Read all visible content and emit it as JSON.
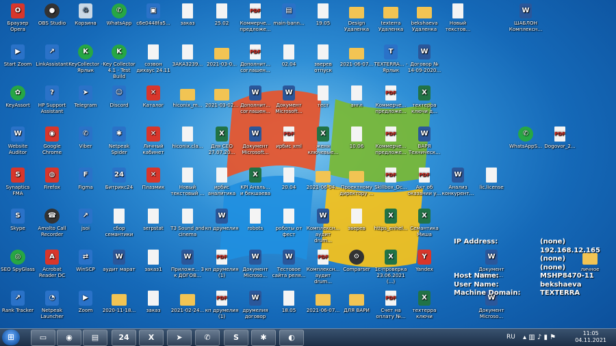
{
  "desktop": {
    "icons": [
      {
        "id": "opera",
        "label": "Браузер Opera",
        "glyph": "O",
        "kind": "red"
      },
      {
        "id": "obs",
        "label": "OBS Studio",
        "glyph": "●",
        "kind": "dark"
      },
      {
        "id": "recycle",
        "label": "Корзина",
        "glyph": "♻",
        "kind": "bin"
      },
      {
        "id": "whatsapp",
        "label": "WhatsApp",
        "glyph": "✆",
        "kind": "green"
      },
      {
        "id": "c6e",
        "label": "c6e0448fa5...",
        "glyph": "▣",
        "kind": "app"
      },
      {
        "id": "zakaz",
        "label": "заказ",
        "glyph": "",
        "kind": "file"
      },
      {
        "id": "d2502",
        "label": "25.02",
        "glyph": "",
        "kind": "file"
      },
      {
        "id": "kommerch1",
        "label": "Коммерче... предложе...",
        "glyph": "PDF",
        "kind": "pdf"
      },
      {
        "id": "mainbann",
        "label": "main-bann...",
        "glyph": "▤",
        "kind": "app"
      },
      {
        "id": "d1905",
        "label": "19.05",
        "glyph": "",
        "kind": "file"
      },
      {
        "id": "design",
        "label": "Design Удаленка",
        "glyph": "",
        "kind": "folder"
      },
      {
        "id": "texterra",
        "label": "texterra Удаленка",
        "glyph": "",
        "kind": "folder"
      },
      {
        "id": "bekshaeva",
        "label": "bekshaeva Удаленка",
        "glyph": "",
        "kind": "folder"
      },
      {
        "id": "newtext",
        "label": "Новый текстов...",
        "glyph": "",
        "kind": "file"
      },
      {
        "id": "shablon",
        "label": "ШАБЛОН Комплексн...",
        "glyph": "W",
        "kind": "word"
      },
      {
        "id": "startzoom",
        "label": "Start Zoom",
        "glyph": "▶",
        "kind": "app"
      },
      {
        "id": "linkassistant",
        "label": "LinkAssistant",
        "glyph": "↗",
        "kind": "app"
      },
      {
        "id": "keycollector",
        "label": "KeyCollector - Ярлык",
        "glyph": "K",
        "kind": "green"
      },
      {
        "id": "keycollector41",
        "label": "Key Collector 4.1 - Test Build",
        "glyph": "K",
        "kind": "green"
      },
      {
        "id": "sozvon",
        "label": "созвон дихаус 24.11",
        "glyph": "",
        "kind": "file"
      },
      {
        "id": "zaka3239",
        "label": "ЗАКА3239...",
        "glyph": "",
        "kind": "file"
      },
      {
        "id": "f2021_03_0",
        "label": "2021-03-0...",
        "glyph": "",
        "kind": "folder"
      },
      {
        "id": "dopoln1",
        "label": "Дополнит... соглашен...",
        "glyph": "PDF",
        "kind": "pdf"
      },
      {
        "id": "d0204",
        "label": "02.04",
        "glyph": "",
        "kind": "file"
      },
      {
        "id": "zvereev",
        "label": "зверев отпуск",
        "glyph": "",
        "kind": "file"
      },
      {
        "id": "f2021_06_07",
        "label": "2021-06-07...",
        "glyph": "",
        "kind": "folder"
      },
      {
        "id": "texterra_y",
        "label": "TEXTERRA... - Ярлык",
        "glyph": "T",
        "kind": "app"
      },
      {
        "id": "dogovor",
        "label": "Договор № 14-09-2020...",
        "glyph": "W",
        "kind": "word"
      },
      {
        "id": "keyassort",
        "label": "KeyAssort",
        "glyph": "✿",
        "kind": "green"
      },
      {
        "id": "hpsupport",
        "label": "HP Support Assistant",
        "glyph": "?",
        "kind": "app"
      },
      {
        "id": "telegram",
        "label": "Telegram",
        "glyph": "➤",
        "kind": "app"
      },
      {
        "id": "discord",
        "label": "Discord",
        "glyph": "☺",
        "kind": "app"
      },
      {
        "id": "katalog",
        "label": "Каталог",
        "glyph": "✕",
        "kind": "red"
      },
      {
        "id": "hiconix_m",
        "label": "hiconix_m...",
        "glyph": "",
        "kind": "folder"
      },
      {
        "id": "f2021_03_02",
        "label": "2021-03-02...",
        "glyph": "",
        "kind": "folder"
      },
      {
        "id": "dopoln2",
        "label": "Дополнит... соглашен...",
        "glyph": "W",
        "kind": "word"
      },
      {
        "id": "doc_ms1",
        "label": "Документ Microsoft...",
        "glyph": "W",
        "kind": "word"
      },
      {
        "id": "test",
        "label": "тест",
        "glyph": "",
        "kind": "file"
      },
      {
        "id": "angl",
        "label": "англ",
        "glyph": "",
        "kind": "file"
      },
      {
        "id": "kommerch2",
        "label": "Коммерче... предложе...",
        "glyph": "PDF",
        "kind": "pdf"
      },
      {
        "id": "texterra_keys",
        "label": "техтерра ключи д...",
        "glyph": "X",
        "kind": "excel"
      },
      {
        "id": "websiteauditor",
        "label": "Website Auditor",
        "glyph": "W",
        "kind": "app"
      },
      {
        "id": "chrome",
        "label": "Google Chrome",
        "glyph": "◉",
        "kind": "red"
      },
      {
        "id": "viber",
        "label": "Viber",
        "glyph": "✆",
        "kind": "app"
      },
      {
        "id": "netpeak",
        "label": "Netpeak Spider",
        "glyph": "✱",
        "kind": "app"
      },
      {
        "id": "lichkab",
        "label": "Личный кабинет",
        "glyph": "✕",
        "kind": "red"
      },
      {
        "id": "hiconix_cla",
        "label": "hiconix.cla...",
        "glyph": "",
        "kind": "file"
      },
      {
        "id": "dlyaceo",
        "label": "Для CEO 27.07.20...",
        "glyph": "X",
        "kind": "excel"
      },
      {
        "id": "doc_ms2",
        "label": "Документ Microsoft...",
        "glyph": "W",
        "kind": "word"
      },
      {
        "id": "irbis_xml",
        "label": "ирбис xml",
        "glyph": "PDF",
        "kind": "pdf"
      },
      {
        "id": "zhenya",
        "label": "женя ключевые...",
        "glyph": "X",
        "kind": "excel"
      },
      {
        "id": "d1006",
        "label": "10.06",
        "glyph": "",
        "kind": "file"
      },
      {
        "id": "kommerch3",
        "label": "Коммерче... предложе...",
        "glyph": "PDF",
        "kind": "pdf"
      },
      {
        "id": "varya_tech",
        "label": "ВАРЯ Техническ...",
        "glyph": "W",
        "kind": "word"
      },
      {
        "id": "whatsapps",
        "label": "WhatsAppS...",
        "glyph": "✆",
        "kind": "green"
      },
      {
        "id": "dogovor2",
        "label": "Dogovor_2...",
        "glyph": "PDF",
        "kind": "pdf"
      },
      {
        "id": "synaptics",
        "label": "Synaptics FMA",
        "glyph": "S",
        "kind": "red"
      },
      {
        "id": "firefox",
        "label": "Firefox",
        "glyph": "◍",
        "kind": "red"
      },
      {
        "id": "figma",
        "label": "Figma",
        "glyph": "F",
        "kind": "app"
      },
      {
        "id": "bitrix24",
        "label": "Битрикс24",
        "glyph": "24",
        "kind": "app"
      },
      {
        "id": "plazmik",
        "label": "Плазмик",
        "glyph": "✕",
        "kind": "red"
      },
      {
        "id": "newtext2",
        "label": "Новый текстовый ...",
        "glyph": "",
        "kind": "file"
      },
      {
        "id": "irbis_an",
        "label": "ирбис аналитика",
        "glyph": "",
        "kind": "file"
      },
      {
        "id": "kpi_anal",
        "label": "KPI Аналь... и бекшаева",
        "glyph": "X",
        "kind": "excel"
      },
      {
        "id": "d2004",
        "label": "20.04",
        "glyph": "",
        "kind": "file"
      },
      {
        "id": "f2021_06_04",
        "label": "2021-06-04...",
        "glyph": "",
        "kind": "folder"
      },
      {
        "id": "proekt",
        "label": "Проектному директору ...",
        "glyph": "",
        "kind": "folder"
      },
      {
        "id": "skillbox",
        "label": "Skillbox_Oc...",
        "glyph": "PDF",
        "kind": "pdf"
      },
      {
        "id": "akt",
        "label": "Акт об оказании у...",
        "glyph": "PDF",
        "kind": "pdf"
      },
      {
        "id": "analiz",
        "label": "Анализ конкурент...",
        "glyph": "W",
        "kind": "word"
      },
      {
        "id": "license",
        "label": "lic.license",
        "glyph": "",
        "kind": "file"
      },
      {
        "id": "skype",
        "label": "Skype",
        "glyph": "S",
        "kind": "app"
      },
      {
        "id": "amolto",
        "label": "Amolto Call Recorder",
        "glyph": "☎",
        "kind": "dark"
      },
      {
        "id": "jsoi",
        "label": "jsoi",
        "glyph": "↗",
        "kind": "app"
      },
      {
        "id": "sbor",
        "label": "сбор семантики",
        "glyph": "",
        "kind": "file"
      },
      {
        "id": "serpstat",
        "label": "serpstat",
        "glyph": "",
        "kind": "file"
      },
      {
        "id": "t3sound",
        "label": "T3 Sound and cinema",
        "glyph": "",
        "kind": "file"
      },
      {
        "id": "kp_drumel",
        "label": "кп друмелия",
        "glyph": "W",
        "kind": "word"
      },
      {
        "id": "robots",
        "label": "robots",
        "glyph": "",
        "kind": "file"
      },
      {
        "id": "roboty",
        "label": "роботы от фест",
        "glyph": "",
        "kind": "file"
      },
      {
        "id": "kompl_audit1",
        "label": "Комплексн... аудит drum...",
        "glyph": "W",
        "kind": "word"
      },
      {
        "id": "zvereev2",
        "label": "зверев",
        "glyph": "",
        "kind": "file"
      },
      {
        "id": "https_enh",
        "label": "https_enhel...",
        "glyph": "X",
        "kind": "excel"
      },
      {
        "id": "semantika",
        "label": "Семантика Миша",
        "glyph": "X",
        "kind": "excel"
      },
      {
        "id": "seospy",
        "label": "SEO SpyGlass",
        "glyph": "◎",
        "kind": "green"
      },
      {
        "id": "acrobat",
        "label": "Acrobat Reader DC",
        "glyph": "A",
        "kind": "red"
      },
      {
        "id": "winscp",
        "label": "WinSCP",
        "glyph": "⇄",
        "kind": "app"
      },
      {
        "id": "audit_marat",
        "label": "аудит марат",
        "glyph": "W",
        "kind": "word"
      },
      {
        "id": "zakaz1",
        "label": "заказ1",
        "glyph": "",
        "kind": "file"
      },
      {
        "id": "prilozh",
        "label": "Приложе... 3 к ДОГОВ...",
        "glyph": "W",
        "kind": "word"
      },
      {
        "id": "kp_drumel1",
        "label": "кп друмелия (1)",
        "glyph": "PDF",
        "kind": "pdf"
      },
      {
        "id": "doc_ms3",
        "label": "Документ Microso...",
        "glyph": "W",
        "kind": "word"
      },
      {
        "id": "testovoe",
        "label": "Тестовое сайта реля...",
        "glyph": "W",
        "kind": "word"
      },
      {
        "id": "kompl_audit2",
        "label": "Комплексн... аудит drum...",
        "glyph": "PDF",
        "kind": "pdf"
      },
      {
        "id": "comparser",
        "label": "Comparser",
        "glyph": "⚙",
        "kind": "dark"
      },
      {
        "id": "1c_prov",
        "label": "1c-проверка 23.06.2021 (...)",
        "glyph": "X",
        "kind": "excel"
      },
      {
        "id": "yandex",
        "label": "Yandex",
        "glyph": "Y",
        "kind": "red"
      },
      {
        "id": "doc_ms4",
        "label": "Документ Microso...",
        "glyph": "W",
        "kind": "word"
      },
      {
        "id": "lichnoe",
        "label": "личное",
        "glyph": "",
        "kind": "folder"
      },
      {
        "id": "ranktracker",
        "label": "Rank Tracker",
        "glyph": "↗",
        "kind": "app"
      },
      {
        "id": "netpeak_l",
        "label": "Netpeak Launcher",
        "glyph": "◔",
        "kind": "app"
      },
      {
        "id": "zoom",
        "label": "Zoom",
        "glyph": "▶",
        "kind": "app"
      },
      {
        "id": "f2020_11_18",
        "label": "2020-11-18...",
        "glyph": "",
        "kind": "folder"
      },
      {
        "id": "zakaz2",
        "label": "заказ",
        "glyph": "",
        "kind": "file"
      },
      {
        "id": "f2021_02_24",
        "label": "2021-02-24...",
        "glyph": "",
        "kind": "folder"
      },
      {
        "id": "kp_drumel2",
        "label": "кп друмелия (1)",
        "glyph": "PDF",
        "kind": "pdf"
      },
      {
        "id": "drumel_dog",
        "label": "друмелия договор",
        "glyph": "W",
        "kind": "word"
      },
      {
        "id": "d1805",
        "label": "18.05",
        "glyph": "",
        "kind": "file"
      },
      {
        "id": "f2021_06_07b",
        "label": "2021-06-07...",
        "glyph": "",
        "kind": "folder"
      },
      {
        "id": "dlya_vari",
        "label": "ДЛЯ ВАРИ",
        "glyph": "",
        "kind": "folder"
      },
      {
        "id": "schet",
        "label": "Счет на оплату №...",
        "glyph": "PDF",
        "kind": "pdf"
      },
      {
        "id": "texterra_k2",
        "label": "техтерра ключи",
        "glyph": "X",
        "kind": "excel"
      },
      {
        "id": "doc_ms5",
        "label": "Документ Microso...",
        "glyph": "W",
        "kind": "word"
      }
    ]
  },
  "bginfo": {
    "rows": [
      {
        "key": "IP Address:",
        "value": "(none)"
      },
      {
        "key": "",
        "value": "192.168.12.165"
      },
      {
        "key": "",
        "value": "(none)"
      },
      {
        "key": "",
        "value": "(none)"
      },
      {
        "key": "Host Name:",
        "value": "MSHP8470-11"
      },
      {
        "key": "User Name:",
        "value": "bekshaeva"
      },
      {
        "key": "Machine Domain:",
        "value": "TEXTERRA"
      }
    ]
  },
  "taskbar": {
    "start_glyph": "⊞",
    "apps": [
      {
        "id": "explorer",
        "glyph": "▭"
      },
      {
        "id": "chrome",
        "glyph": "◉"
      },
      {
        "id": "notepad",
        "glyph": "▤"
      },
      {
        "id": "bitrix",
        "glyph": "24"
      },
      {
        "id": "excel",
        "glyph": "X"
      },
      {
        "id": "telegram",
        "glyph": "➤"
      },
      {
        "id": "whatsapp",
        "glyph": "✆"
      },
      {
        "id": "skype",
        "glyph": "S"
      },
      {
        "id": "network",
        "glyph": "✱"
      },
      {
        "id": "android",
        "glyph": "◐"
      }
    ],
    "lang": "RU",
    "time": "11:05",
    "date": "04.11.2021"
  }
}
